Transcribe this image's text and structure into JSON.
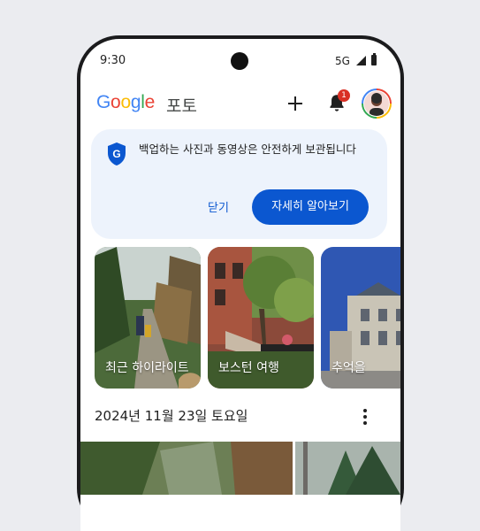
{
  "status_bar": {
    "time": "9:30",
    "network": "5G"
  },
  "app_bar": {
    "logo_letters": [
      {
        "ch": "G",
        "color": "#4285f4"
      },
      {
        "ch": "o",
        "color": "#ea4335"
      },
      {
        "ch": "o",
        "color": "#fbbc05"
      },
      {
        "ch": "g",
        "color": "#4285f4"
      },
      {
        "ch": "l",
        "color": "#34a853"
      },
      {
        "ch": "e",
        "color": "#ea4335"
      }
    ],
    "product": "포토",
    "notification_count": "1",
    "icons": [
      "plus-icon",
      "bell-icon",
      "avatar"
    ]
  },
  "backup_card": {
    "message": "백업하는 사진과 동영상은 안전하게 보관됩니다",
    "close_label": "닫기",
    "learn_more_label": "자세히 알아보기",
    "accent": "#0b57d0"
  },
  "memories": [
    {
      "label": "최근 하이라이트"
    },
    {
      "label": "보스턴 여행"
    },
    {
      "label": "추억을"
    }
  ],
  "date_header": "2024년 11월 23일 토요일",
  "colors": {
    "background": "#ebecf0",
    "card": "#edf3fc",
    "primary": "#0b57d0"
  }
}
